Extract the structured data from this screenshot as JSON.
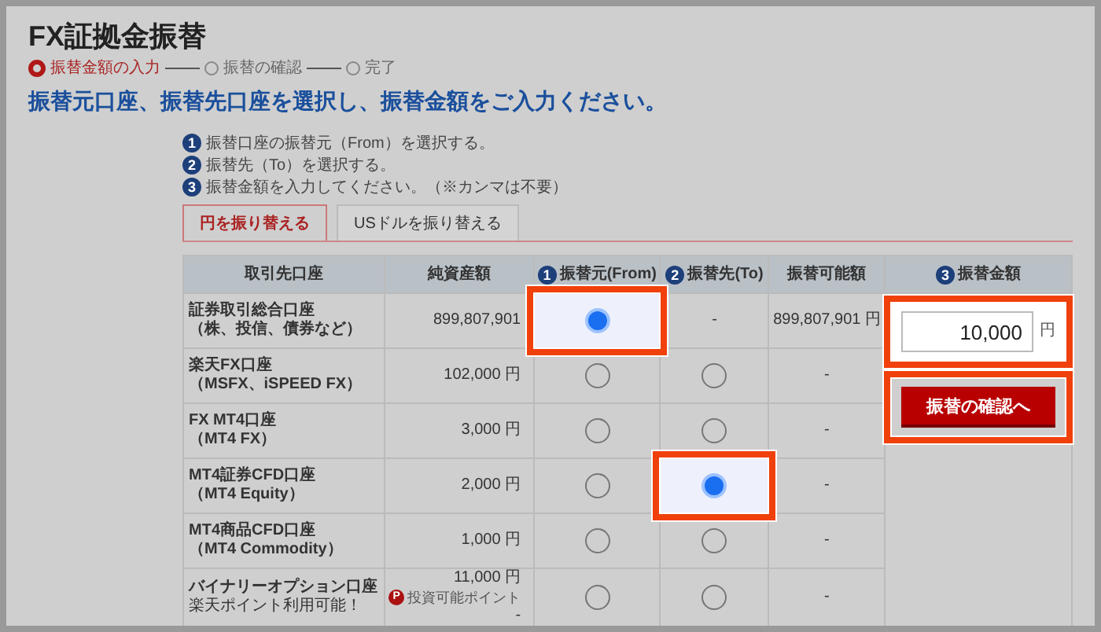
{
  "page_title": "FX証拠金振替",
  "steps": [
    {
      "label": "振替金額の入力",
      "selected": true
    },
    {
      "label": "振替の確認",
      "selected": false
    },
    {
      "label": "完了",
      "selected": false
    }
  ],
  "headline": "振替元口座、振替先口座を選択し、振替金額をご入力ください。",
  "instructions": [
    {
      "number": "1",
      "text": "振替口座の振替元（From）を選択する。"
    },
    {
      "number": "2",
      "text": "振替先（To）を選択する。"
    },
    {
      "number": "3",
      "text": "振替金額を入力してください。（※カンマは不要）"
    }
  ],
  "tabs": [
    {
      "label": "円を振り替える",
      "selected": true
    },
    {
      "label": "USドルを振り替える",
      "selected": false
    }
  ],
  "table": {
    "columns": [
      {
        "label": "取引先口座"
      },
      {
        "label": "純資産額"
      },
      {
        "number": "1",
        "label": "振替元(From)"
      },
      {
        "number": "2",
        "label": "振替先(To)"
      },
      {
        "label": "振替可能額"
      },
      {
        "number": "3",
        "label": "振替金額"
      }
    ],
    "rows": [
      {
        "account": "証券取引総合口座",
        "account_sub": "（株、投信、債券など）",
        "net_assets": "899,807,901",
        "from": {
          "kind": "radio",
          "selected": true,
          "highlighted": true
        },
        "to": {
          "kind": "text",
          "text": "-",
          "highlighted": false
        },
        "available": "899,807,901 円"
      },
      {
        "account": "楽天FX口座",
        "account_sub": "（MSFX、iSPEED FX）",
        "net_assets": "102,000 円",
        "from": {
          "kind": "radio",
          "selected": false,
          "highlighted": false
        },
        "to": {
          "kind": "radio",
          "selected": false,
          "highlighted": false
        },
        "available": "-"
      },
      {
        "account": "FX MT4口座",
        "account_sub": "（MT4 FX）",
        "net_assets": "3,000 円",
        "from": {
          "kind": "radio",
          "selected": false,
          "highlighted": false
        },
        "to": {
          "kind": "radio",
          "selected": false,
          "highlighted": false
        },
        "available": "-"
      },
      {
        "account": "MT4証券CFD口座",
        "account_sub": "（MT4 Equity）",
        "net_assets": "2,000 円",
        "from": {
          "kind": "radio",
          "selected": false,
          "highlighted": false
        },
        "to": {
          "kind": "radio",
          "selected": true,
          "highlighted": true
        },
        "available": "-"
      },
      {
        "account": "MT4商品CFD口座",
        "account_sub": "（MT4 Commodity）",
        "net_assets": "1,000 円",
        "from": {
          "kind": "radio",
          "selected": false,
          "highlighted": false
        },
        "to": {
          "kind": "radio",
          "selected": false,
          "highlighted": false
        },
        "available": "-"
      },
      {
        "account": "バイナリーオプション口座",
        "account_note": "楽天ポイント利用可能！",
        "net_assets": "11,000 円",
        "point_badge": {
          "icon_text": "P",
          "label": "投資可能ポイント",
          "value": "-"
        },
        "from": {
          "kind": "radio",
          "selected": false,
          "highlighted": false
        },
        "to": {
          "kind": "radio",
          "selected": false,
          "highlighted": false
        },
        "available": "-"
      }
    ]
  },
  "amount": {
    "value": "10,000",
    "unit": "円",
    "highlighted": true
  },
  "confirm_button": {
    "label": "振替の確認へ",
    "highlighted": true
  }
}
